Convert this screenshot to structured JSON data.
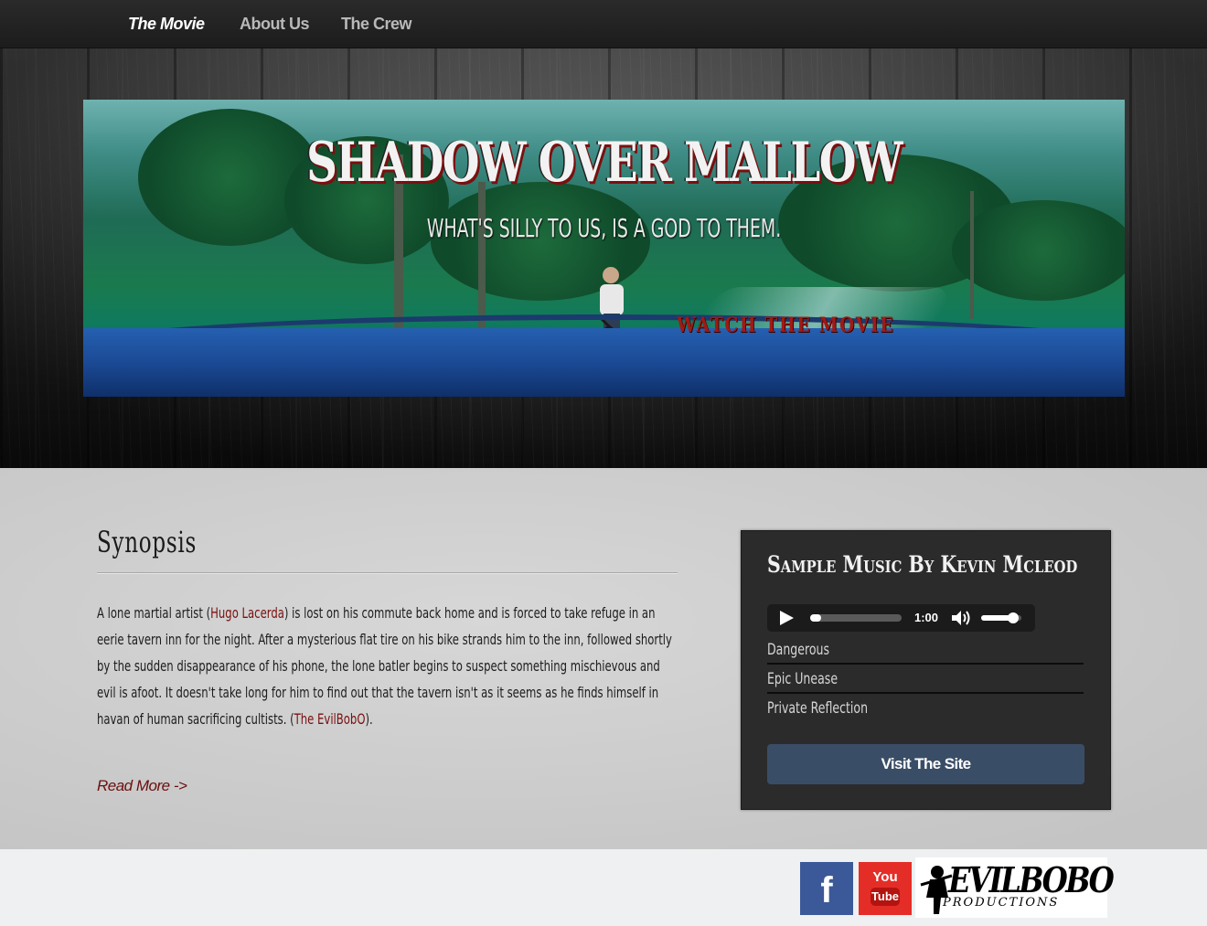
{
  "nav": {
    "items": [
      {
        "label": "The Movie",
        "active": true
      },
      {
        "label": "About Us",
        "active": false
      },
      {
        "label": "The Crew",
        "active": false
      }
    ]
  },
  "banner": {
    "title": "SHADOW OVER MALLOW",
    "tagline": "WHAT'S SILLY TO US, IS A GOD TO THEM.",
    "watch_label": "WATCH THE MOVIE"
  },
  "synopsis": {
    "title": "Synopsis",
    "body_part1": "A lone martial artist (",
    "actor_link": "Hugo Lacerda",
    "body_part2": ") is lost on his commute back home and is forced to take refuge in an eerie tavern inn for the night. After a mysterious flat tire on his bike strands him to the inn, followed shortly by the sudden disappearance of his phone, the lone batler begins to suspect something mischievous and evil is afoot. It doesn't take long for him to find out that the tavern isn't as it seems as he finds himself in havan of human sacrificing cultists. (",
    "director_link": "The EvilBobO",
    "body_part3": ").",
    "read_more": "Read More ->"
  },
  "music": {
    "title": "Sample Music By Kevin Mcleod",
    "player": {
      "time": "1:00",
      "progress": 0.1,
      "volume": 0.8
    },
    "tracks": [
      "Dangerous",
      "Epic Unease",
      "Private Reflection"
    ],
    "visit_label": "Visit The Site"
  },
  "footer": {
    "facebook_letter": "f",
    "youtube_top": "You",
    "youtube_bottom": "Tube",
    "logo_main": "EVILBOBO",
    "logo_sub": "PRODUCTIONS",
    "facebook_color": "#3b5998",
    "youtube_color": "#e52d27"
  },
  "colors": {
    "accent_link": "#7a1010",
    "button": "#3a4d66",
    "panel_bg": "#2b2b2b"
  },
  "icons": {
    "play": "play-icon",
    "volume": "volume-icon",
    "facebook": "facebook-icon",
    "youtube": "youtube-icon"
  }
}
